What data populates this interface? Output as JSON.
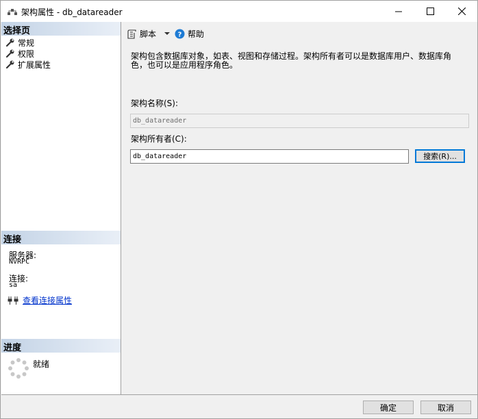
{
  "window": {
    "title": "架构属性 - db_datareader"
  },
  "left_panel": {
    "select_page_header": "选择页",
    "pages": [
      {
        "label": "常规",
        "icon": "wrench-icon"
      },
      {
        "label": "权限",
        "icon": "wrench-icon"
      },
      {
        "label": "扩展属性",
        "icon": "wrench-icon"
      }
    ],
    "connection_header": "连接",
    "server_label": "服务器:",
    "server_value": "NVRPC",
    "connection_label": "连接:",
    "connection_value": "sa",
    "view_connection_link": "查看连接属性",
    "progress_header": "进度",
    "progress_status": "就绪"
  },
  "toolbar": {
    "script_label": "脚本",
    "help_label": "帮助"
  },
  "main": {
    "description": "架构包含数据库对象，如表、视图和存储过程。架构所有者可以是数据库用户、数据库角色，也可以是应用程序角色。",
    "schema_name_label": "架构名称(S):",
    "schema_name_value": "db_datareader",
    "schema_owner_label": "架构所有者(C):",
    "schema_owner_value": "db_datareader",
    "search_button": "搜索(R)..."
  },
  "footer": {
    "ok_button": "确定",
    "cancel_button": "取消"
  },
  "colors": {
    "section_header_start": "#c3d3e6",
    "link": "#0033cc",
    "focus_border": "#0078d7"
  }
}
